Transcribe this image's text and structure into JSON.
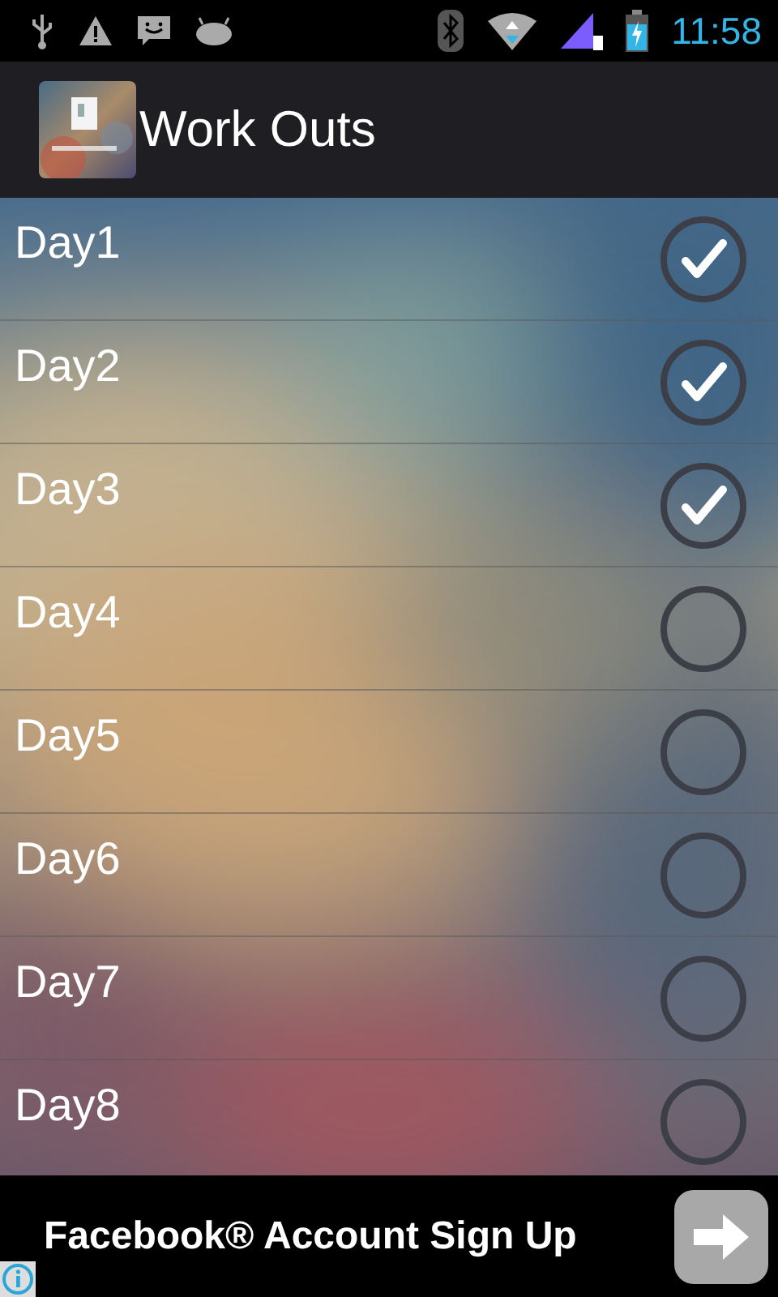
{
  "status_bar": {
    "time": "11:58"
  },
  "app_bar": {
    "title": "Work Outs"
  },
  "days": [
    {
      "label": "Day1",
      "checked": true
    },
    {
      "label": "Day2",
      "checked": true
    },
    {
      "label": "Day3",
      "checked": true
    },
    {
      "label": "Day4",
      "checked": false
    },
    {
      "label": "Day5",
      "checked": false
    },
    {
      "label": "Day6",
      "checked": false
    },
    {
      "label": "Day7",
      "checked": false
    },
    {
      "label": "Day8",
      "checked": false
    }
  ],
  "ad": {
    "text": "Facebook® Account Sign Up"
  }
}
